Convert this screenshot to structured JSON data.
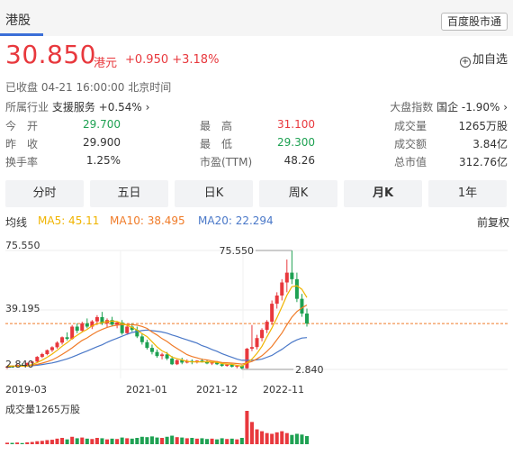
{
  "header": {
    "tab": "港股",
    "badge": "百度股市通"
  },
  "quote": {
    "price": "30.850",
    "currency": "港元",
    "change": "+0.950 +3.18%",
    "watch_label": "加自选",
    "status": "已收盘  04-21 16:00:00  北京时间",
    "industry_label": "所属行业",
    "industry_value": "支援服务 +0.54% ›",
    "index_label": "大盘指数",
    "index_value": "国企 -1.90% ›"
  },
  "stats": {
    "open_label": "今　开",
    "open": "29.700",
    "prev_label": "昨　收",
    "prev": "29.900",
    "turnover_rate_label": "换手率",
    "turnover_rate": "1.25%",
    "high_label": "最　高",
    "high": "31.100",
    "low_label": "最　低",
    "low": "29.300",
    "pe_label": "市盈(TTM)",
    "pe": "48.26",
    "volume_label": "成交量",
    "volume": "1265万股",
    "amount_label": "成交额",
    "amount": "3.84亿",
    "mcap_label": "总市值",
    "mcap": "312.76亿"
  },
  "tabs": [
    "分时",
    "五日",
    "日K",
    "周K",
    "月K",
    "1年"
  ],
  "active_tab": "月K",
  "ma": {
    "label": "均线",
    "ma5": "MA5: 45.11",
    "ma10": "MA10: 38.495",
    "ma20": "MA20: 22.294",
    "adjust": "前复权"
  },
  "colors": {
    "up": "#e8383d",
    "down": "#1ea152",
    "ma5": "#f0b400",
    "ma10": "#f07b28",
    "ma20": "#4a78c8"
  },
  "chart_data": {
    "type": "candlestick",
    "y_labels": [
      "75.550",
      "39.195",
      "2.840"
    ],
    "x_labels": [
      "2019-03",
      "2021-01",
      "2021-12",
      "2022-11"
    ],
    "max_marker": "75.550",
    "min_marker": "2.840",
    "current_price": 30.85,
    "volume_label": "成交量1265万股",
    "candles": [
      [
        4.0,
        5.0,
        3.2,
        4.6
      ],
      [
        4.6,
        5.2,
        4.0,
        4.4
      ],
      [
        4.4,
        6.0,
        4.2,
        5.6
      ],
      [
        5.6,
        6.5,
        5.0,
        5.2
      ],
      [
        5.2,
        7.0,
        5.0,
        6.8
      ],
      [
        6.8,
        8.0,
        6.0,
        7.6
      ],
      [
        7.6,
        11.0,
        7.2,
        10.5
      ],
      [
        10.5,
        13.0,
        9.8,
        12.2
      ],
      [
        12.2,
        15.0,
        11.5,
        14.6
      ],
      [
        14.6,
        17.0,
        13.5,
        16.4
      ],
      [
        16.4,
        20.0,
        15.5,
        19.2
      ],
      [
        19.2,
        23.0,
        18.0,
        22.5
      ],
      [
        22.5,
        25.5,
        20.5,
        21.5
      ],
      [
        21.5,
        30.0,
        21.0,
        29.0
      ],
      [
        29.0,
        31.0,
        25.0,
        26.5
      ],
      [
        26.5,
        32.0,
        25.5,
        31.0
      ],
      [
        31.0,
        34.0,
        28.0,
        29.0
      ],
      [
        29.0,
        33.0,
        27.5,
        32.2
      ],
      [
        32.2,
        36.0,
        30.0,
        34.8
      ],
      [
        34.8,
        38.0,
        30.0,
        31.0
      ],
      [
        31.0,
        34.0,
        28.5,
        33.0
      ],
      [
        33.0,
        35.0,
        29.0,
        30.2
      ],
      [
        30.2,
        32.0,
        28.0,
        31.5
      ],
      [
        31.5,
        33.0,
        24.0,
        25.0
      ],
      [
        25.0,
        30.0,
        24.0,
        29.0
      ],
      [
        29.0,
        31.0,
        26.0,
        27.0
      ],
      [
        27.0,
        29.0,
        22.0,
        23.0
      ],
      [
        23.0,
        25.0,
        18.0,
        19.5
      ],
      [
        19.5,
        21.0,
        15.0,
        16.0
      ],
      [
        16.0,
        18.0,
        12.0,
        13.5
      ],
      [
        13.5,
        15.0,
        10.0,
        11.0
      ],
      [
        11.0,
        13.0,
        9.0,
        12.0
      ],
      [
        12.0,
        13.5,
        8.5,
        9.5
      ],
      [
        9.5,
        11.0,
        5.5,
        6.0
      ],
      [
        6.0,
        9.0,
        5.5,
        8.5
      ],
      [
        8.5,
        10.0,
        6.0,
        7.0
      ],
      [
        7.0,
        9.0,
        6.5,
        8.0
      ],
      [
        8.0,
        9.0,
        6.0,
        7.2
      ],
      [
        7.2,
        8.5,
        6.5,
        8.2
      ],
      [
        8.2,
        9.5,
        7.0,
        7.5
      ],
      [
        7.5,
        8.5,
        6.0,
        6.5
      ],
      [
        6.5,
        7.5,
        5.5,
        7.0
      ],
      [
        7.0,
        8.0,
        5.5,
        6.0
      ],
      [
        6.0,
        7.0,
        4.5,
        5.0
      ],
      [
        5.0,
        6.0,
        4.5,
        5.8
      ],
      [
        5.8,
        6.2,
        4.0,
        4.5
      ],
      [
        4.5,
        5.5,
        3.5,
        5.0
      ],
      [
        5.0,
        5.5,
        2.84,
        3.5
      ],
      [
        3.5,
        16.0,
        3.2,
        15.5
      ],
      [
        15.5,
        30.0,
        14.0,
        16.5
      ],
      [
        16.5,
        24.0,
        15.0,
        22.0
      ],
      [
        22.0,
        28.0,
        20.0,
        27.0
      ],
      [
        27.0,
        33.0,
        25.0,
        32.0
      ],
      [
        32.0,
        45.0,
        30.0,
        43.0
      ],
      [
        43.0,
        50.0,
        40.0,
        48.0
      ],
      [
        48.0,
        58.0,
        45.0,
        56.0
      ],
      [
        56.0,
        70.0,
        50.0,
        62.0
      ],
      [
        62.0,
        75.55,
        55.0,
        58.0
      ],
      [
        58.0,
        62.0,
        44.0,
        46.0
      ],
      [
        46.0,
        49.0,
        35.0,
        37.0
      ],
      [
        37.0,
        40.0,
        29.0,
        30.85
      ]
    ],
    "volumes": [
      40,
      35,
      45,
      30,
      50,
      60,
      80,
      90,
      110,
      120,
      150,
      170,
      130,
      200,
      160,
      180,
      150,
      140,
      170,
      160,
      130,
      150,
      140,
      180,
      160,
      150,
      170,
      200,
      190,
      210,
      180,
      170,
      200,
      230,
      190,
      180,
      160,
      170,
      150,
      160,
      140,
      150,
      130,
      160,
      140,
      150,
      130,
      170,
      900,
      600,
      400,
      350,
      300,
      280,
      320,
      350,
      300,
      250,
      280,
      260,
      220
    ],
    "ma_series": {
      "ma5": [
        4.8,
        4.8,
        4.8,
        4.8,
        4.9,
        5.9,
        7.0,
        8.5,
        10.3,
        12.2,
        14.5,
        17.0,
        19.2,
        21.7,
        23.7,
        25.7,
        27.3,
        29.5,
        30.7,
        31.6,
        32.0,
        32.4,
        32.1,
        30.9,
        29.9,
        28.5,
        26.9,
        24.7,
        22.9,
        19.8,
        16.6,
        14.2,
        12.7,
        10.4,
        9.4,
        8.6,
        7.8,
        7.4,
        7.5,
        7.4,
        7.5,
        7.3,
        7.2,
        6.4,
        6.1,
        5.9,
        5.3,
        4.8,
        6.9,
        9.1,
        12.6,
        17.0,
        22.7,
        28.1,
        34.4,
        41.2,
        48.2,
        53.4,
        54.0,
        51.8,
        46.8
      ],
      "ma10": [
        4.8,
        4.8,
        4.8,
        4.8,
        4.9,
        5.4,
        5.9,
        6.7,
        7.6,
        8.6,
        10.2,
        12.0,
        13.9,
        16.0,
        18.3,
        20.6,
        22.1,
        24.1,
        25.9,
        27.3,
        28.5,
        29.4,
        29.9,
        30.2,
        30.3,
        30.2,
        29.9,
        29.1,
        27.9,
        25.7,
        23.9,
        21.7,
        19.9,
        17.6,
        15.7,
        13.7,
        11.9,
        10.7,
        9.9,
        9.0,
        8.6,
        8.0,
        7.6,
        7.1,
        6.9,
        6.7,
        6.4,
        6.1,
        6.8,
        7.7,
        9.3,
        11.2,
        13.9,
        16.9,
        21.0,
        25.1,
        30.1,
        34.8,
        38.2,
        40.4,
        42.2
      ],
      "ma20": [
        4.8,
        4.8,
        4.8,
        4.8,
        4.9,
        5.1,
        5.4,
        5.8,
        6.3,
        6.8,
        7.5,
        8.4,
        9.3,
        10.4,
        11.6,
        12.9,
        14.1,
        15.4,
        16.7,
        17.9,
        19.4,
        20.7,
        21.9,
        23.1,
        24.3,
        25.4,
        26.0,
        26.6,
        26.9,
        26.5,
        26.2,
        25.7,
        25.0,
        23.9,
        23.0,
        21.9,
        20.9,
        19.9,
        18.9,
        17.4,
        16.4,
        15.0,
        13.9,
        12.4,
        11.3,
        10.2,
        9.1,
        8.4,
        8.4,
        8.4,
        8.7,
        9.1,
        10.3,
        11.4,
        13.3,
        15.1,
        17.3,
        19.4,
        20.9,
        22.0,
        22.3
      ]
    }
  }
}
